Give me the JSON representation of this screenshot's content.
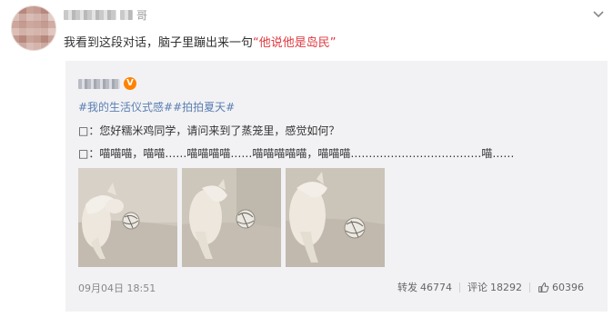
{
  "post": {
    "author": {
      "name": "哥"
    },
    "text": "我看到这段对话，脑子里蹦出来一句",
    "quote": "“他说他是岛民”"
  },
  "repost": {
    "verified_badge": "V",
    "tags": [
      "#我的生活仪式感#",
      "#拍拍夏天#"
    ],
    "lines": [
      "□：您好糯米鸡同学，请问来到了蒸笼里，感觉如何？",
      "□：喵喵喵，喵喵……喵喵喵喵……喵喵喵喵喵，喵喵喵………………………………喵……"
    ],
    "photos": [
      {
        "name": "cat-photo-1"
      },
      {
        "name": "cat-photo-2"
      },
      {
        "name": "cat-photo-3"
      }
    ],
    "time": "09月04日 18:51",
    "repost_label": "转发",
    "repost_count": "46774",
    "comment_label": "评论",
    "comment_count": "18292",
    "like_count": "60396",
    "like_icon": "thumbs-up-icon"
  },
  "colors": {
    "quote_red": "#e0383f",
    "tag_blue": "#5a7fb0",
    "repost_bg": "#f2f2f5",
    "vip_orange": "#ff8200"
  }
}
